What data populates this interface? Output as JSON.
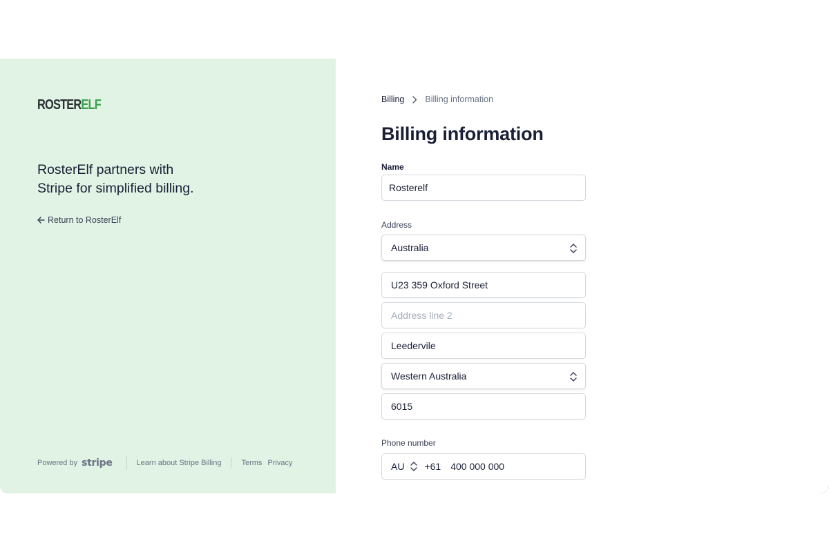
{
  "brand": {
    "logo_roster": "ROSTER",
    "logo_elf": "ELF",
    "tagline_line1": "RosterElf partners with",
    "tagline_line2": "Stripe for simplified billing.",
    "return_label": "Return to RosterElf"
  },
  "footer": {
    "powered_by": "Powered by",
    "stripe": "stripe",
    "learn": "Learn about Stripe Billing",
    "terms": "Terms",
    "privacy": "Privacy"
  },
  "breadcrumb": {
    "root": "Billing",
    "current": "Billing information"
  },
  "page": {
    "title": "Billing information"
  },
  "form": {
    "name_label": "Name",
    "name_value": "Rosterelf",
    "address_label": "Address",
    "country": "Australia",
    "address_line1": "U23 359 Oxford Street",
    "address_line2_placeholder": "Address line 2",
    "city": "Leedervile",
    "state": "Western Australia",
    "postal_code": "6015",
    "phone_label": "Phone number",
    "phone_country": "AU",
    "phone_dial_code": "+61",
    "phone_number": "400 000 000"
  },
  "colors": {
    "left_panel_bg": "#e0f3e4",
    "brand_green": "#3aa24a",
    "text_primary": "#1a1f36",
    "text_muted": "#697386"
  },
  "icons": {
    "return": "arrow-left-icon",
    "breadcrumb_separator": "chevron-right-icon",
    "select": "chevron-up-down-icon"
  }
}
